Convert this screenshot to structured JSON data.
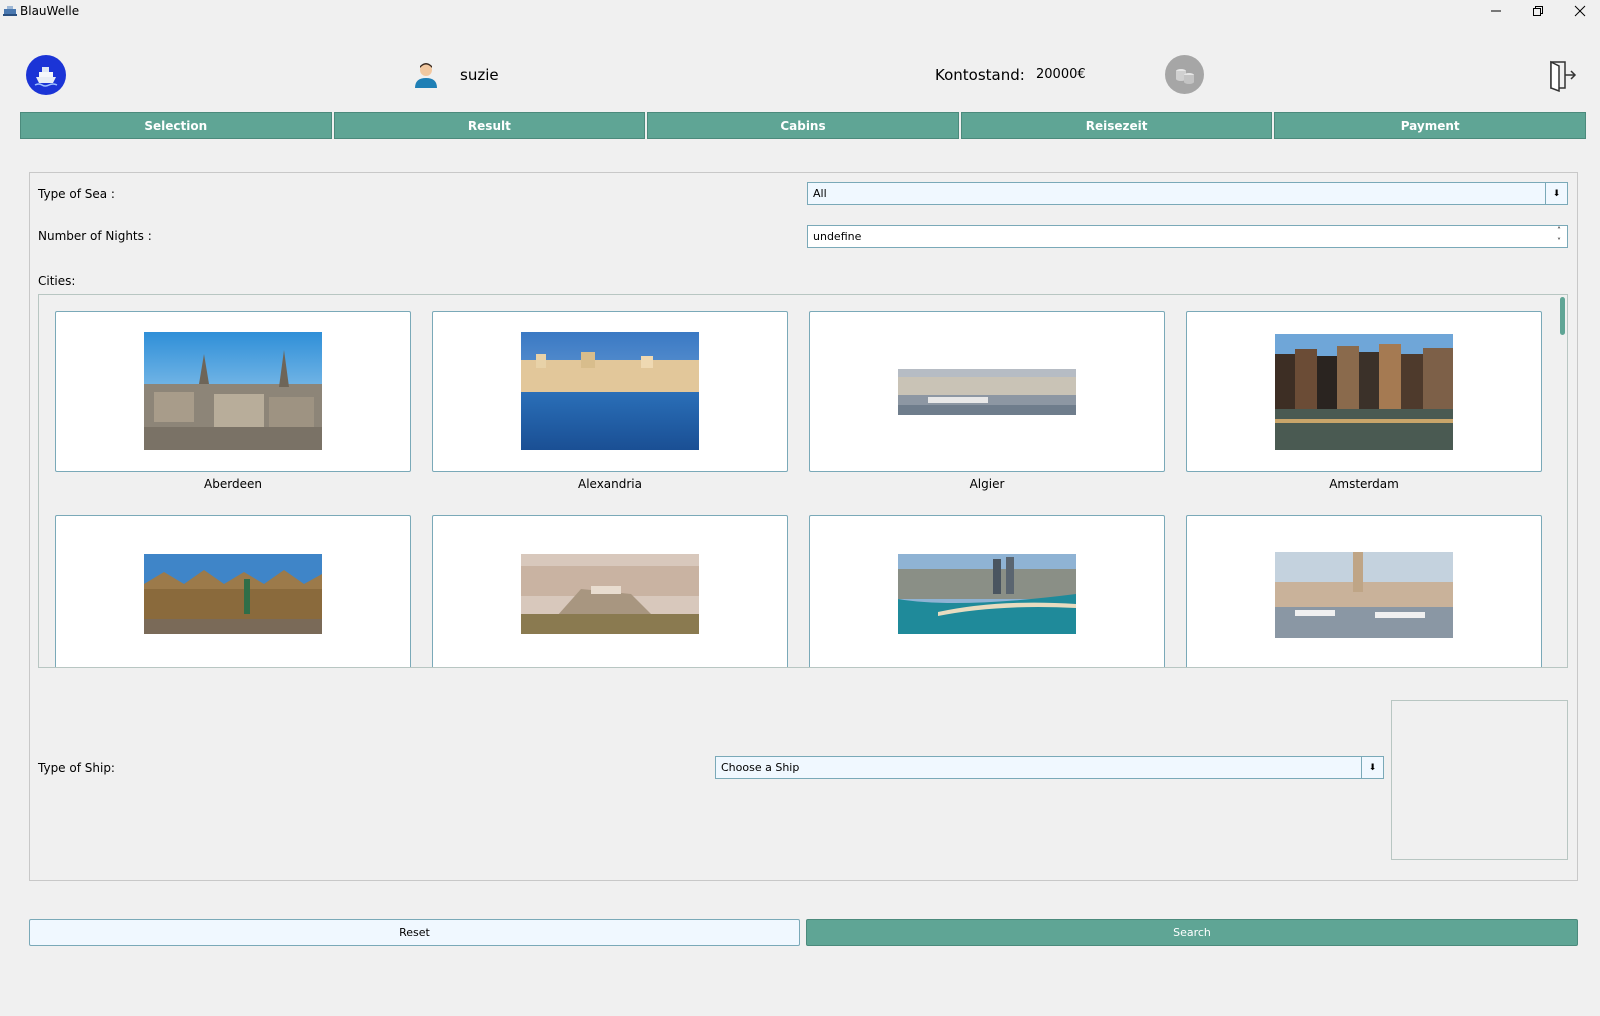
{
  "window": {
    "title": "BlauWelle",
    "controls": [
      "minimize-icon",
      "restore-icon",
      "close-icon"
    ]
  },
  "header": {
    "username": "suzie",
    "balance_label": "Kontostand:",
    "balance_value": "20000€",
    "icons": [
      "ship-logo-icon",
      "user-avatar-icon",
      "coins-icon",
      "logout-icon"
    ]
  },
  "tabs": [
    {
      "label": "Selection"
    },
    {
      "label": "Result"
    },
    {
      "label": "Cabins"
    },
    {
      "label": "Reisezeit"
    },
    {
      "label": "Payment"
    }
  ],
  "form": {
    "sea_type": {
      "label": "Type of Sea :",
      "value": "All"
    },
    "nights": {
      "label": "Number of Nights :",
      "value": "undefine"
    },
    "cities_label": "Cities:",
    "cities": [
      {
        "name": "Aberdeen"
      },
      {
        "name": "Alexandria"
      },
      {
        "name": "Algier"
      },
      {
        "name": "Amsterdam"
      },
      {
        "name": ""
      },
      {
        "name": ""
      },
      {
        "name": ""
      },
      {
        "name": ""
      }
    ],
    "ship_type": {
      "label": "Type of Ship:",
      "value": "Choose a Ship"
    }
  },
  "buttons": {
    "reset": "Reset",
    "search": "Search"
  },
  "colors": {
    "accent": "#5fa595",
    "logo": "#1b34d6",
    "field_border": "#7aa9b8",
    "field_bg": "#f0f8ff"
  }
}
